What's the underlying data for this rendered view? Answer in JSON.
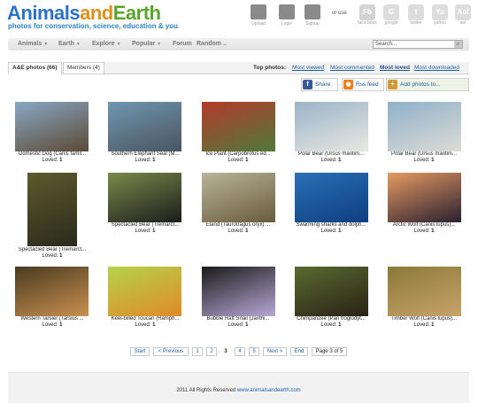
{
  "brand": {
    "part1": "Animals",
    "part2": "and",
    "part3": "Earth",
    "tagline": "photos for conservation, science, education & you"
  },
  "account": {
    "upload": "Upload",
    "login": "Login",
    "signup": "Signup",
    "or_use": "or use"
  },
  "social": [
    {
      "letter": "Fb",
      "label": "face book",
      "color": "#d4d4d4"
    },
    {
      "letter": "G",
      "label": "google",
      "color": "#dddddd"
    },
    {
      "letter": "t",
      "label": "twitter",
      "color": "#dddddd"
    },
    {
      "letter": "Ya",
      "label": "yahoo",
      "color": "#dddddd"
    },
    {
      "letter": "Aol",
      "label": "aol",
      "color": "#dddddd"
    }
  ],
  "nav": {
    "animals": "Animals",
    "earth": "Earth",
    "explore": "Explore",
    "popular": "Popular",
    "forum": "Forum",
    "random": "Random",
    "random_suffix": "..",
    "search_placeholder": "Search..."
  },
  "tabs": {
    "photos": "A&E photos (66)",
    "members": "Members (4)"
  },
  "top_photos": {
    "label": "Top photos:",
    "most_viewed": "Most viewed",
    "most_commented": "Most commented",
    "most_loved": "Most loved",
    "most_downloaded": "Most downloaded"
  },
  "actions": {
    "share": "Share",
    "rss": "Rss feed",
    "add": "Add photos to..."
  },
  "photos": [
    {
      "caption": "Domestic Dog (Canis famil...",
      "loved_label": "Loved:",
      "loved": "1",
      "colors": [
        "#8aa7c4",
        "#5b4a35"
      ]
    },
    {
      "caption": "Southern Elephant Seal (M...",
      "loved_label": "Loved:",
      "loved": "1",
      "colors": [
        "#6f97b0",
        "#4a5560"
      ]
    },
    {
      "caption": "Ice Plant (Carpobrotus ed...",
      "loved_label": "Loved:",
      "loved": "1",
      "colors": [
        "#b43a2a",
        "#4f7a3a"
      ]
    },
    {
      "caption": "Polar Bear (Ursus maritim...",
      "loved_label": "Loved:",
      "loved": "1",
      "colors": [
        "#9ab3c8",
        "#e8e8e2"
      ]
    },
    {
      "caption": "Polar Bear (Ursus maritim...",
      "loved_label": "Loved:",
      "loved": "1",
      "colors": [
        "#8fb0c9",
        "#dcdcd6"
      ]
    },
    {
      "caption": "Spectacled Bear (Tremarct...",
      "loved_label": "Loved:",
      "loved": "1",
      "colors": [
        "#5d5a2c",
        "#2a2a1c"
      ]
    },
    {
      "caption": "Spectacled Bear (Tremarct...",
      "loved_label": "Loved:",
      "loved": "1",
      "colors": [
        "#7a8a4a",
        "#1c1c1c"
      ]
    },
    {
      "caption": "Eland (Taurotragus oryx) ...",
      "loved_label": "Loved:",
      "loved": "1",
      "colors": [
        "#b9b399",
        "#6a5c3c"
      ]
    },
    {
      "caption": "Swarming sharks and dolph...",
      "loved_label": "Loved:",
      "loved": "1",
      "colors": [
        "#2a6fb5",
        "#0e3f80"
      ]
    },
    {
      "caption": "Arctic Wolf (Canis lupus)...",
      "loved_label": "Loved:",
      "loved": "1",
      "colors": [
        "#e59a62",
        "#2a2030"
      ]
    },
    {
      "caption": "Western Tarsier (Tarsius ...",
      "loved_label": "Loved:",
      "loved": "1",
      "colors": [
        "#4a3a20",
        "#c89050"
      ]
    },
    {
      "caption": "Keel-billed Toucan (Ramph...",
      "loved_label": "Loved:",
      "loved": "1",
      "colors": [
        "#b5d24a",
        "#e08a2a"
      ]
    },
    {
      "caption": "Bubble Raft Snail (Janthi...",
      "loved_label": "Loved:",
      "loved": "1",
      "colors": [
        "#1a1a1a",
        "#b7a8d6"
      ]
    },
    {
      "caption": "Chimpanzee (Pan troglodyt...",
      "loved_label": "Loved:",
      "loved": "1",
      "colors": [
        "#5a6a30",
        "#2a2216"
      ]
    },
    {
      "caption": "Timber Wolf (Canis lupus)...",
      "loved_label": "Loved:",
      "loved": "1",
      "colors": [
        "#8a7a3a",
        "#c9a26a"
      ]
    }
  ],
  "pagination": {
    "start": "Start",
    "prev": "< Previous",
    "p1": "1",
    "p2": "2",
    "p3": "3",
    "p4": "4",
    "p5": "5",
    "next": "Next >",
    "end": "End",
    "info": "Page 3 of 5"
  },
  "footer": {
    "text": "2011 All Rights Reserved",
    "link": "www.animalsandearth.com"
  }
}
